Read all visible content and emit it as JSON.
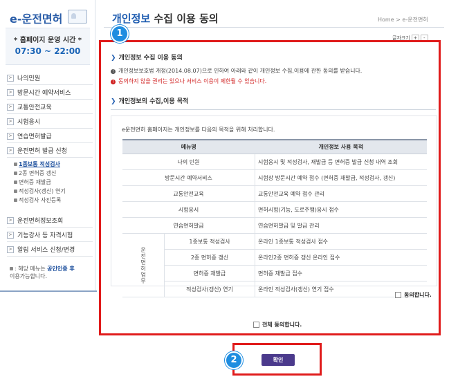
{
  "sidebar": {
    "logo": "e-운전면허",
    "hours_title": "* 홈페이지 운영 시간 *",
    "hours_time": "07:30 ~ 22:00",
    "menu": [
      {
        "label": "나의민원"
      },
      {
        "label": "방문시간 예약서비스"
      },
      {
        "label": "교통안전교육"
      },
      {
        "label": "시험응시"
      },
      {
        "label": "연습면허발급"
      },
      {
        "label": "운전면허 발급 신청"
      }
    ],
    "submenu": [
      {
        "label": "1종보통 적성검사"
      },
      {
        "label": "2종 면허증 갱신"
      },
      {
        "label": "면허증 재발급"
      },
      {
        "label": "적성검사(갱신) 연기"
      },
      {
        "label": "적성검사 사진등록"
      }
    ],
    "menu2": [
      {
        "label": "운전면허정보조회"
      },
      {
        "label": "기능강사 등 자격시험"
      },
      {
        "label": "알림 서비스 신청/변경"
      }
    ],
    "notice_prefix": ": 해당 메뉴는",
    "notice_link": "공인인증 후",
    "notice_suffix": "이용가능합니다."
  },
  "header": {
    "title_hl": "개인정보",
    "title_rest": " 수집 이용 동의",
    "breadcrumb": "Home > e-운전면허",
    "font_label": "글자크기",
    "font_plus": "+",
    "font_minus": "-"
  },
  "badges": {
    "one": "1",
    "two": "2"
  },
  "section1": {
    "title": "개인정보 수집 이용 동의",
    "line1": "개인정보보호법 개정(2014.08.07)으로 인하여 아래와 같이 개인정보 수집,이용에 관한 동의를 받습니다.",
    "line2": "동의하지 않을 권리는 있으나 서비스 이용이 제한될 수 있습니다."
  },
  "section2": {
    "title": "개인정보의 수집,이용 목적",
    "intro": "e운전면허 홈페이지는 개인정보를 다음의 목적을 위해 처리합니다.",
    "col_menu": "메뉴명",
    "col_purpose": "개인정보 사용 목적",
    "rows": [
      {
        "menu": "나의 민원",
        "purpose": "시험응시 및 적성검사, 재발급 등 면허증 발급 신청 내역 조회"
      },
      {
        "menu": "방문시간 예약서비스",
        "purpose": "시험장 방문시간 예약 접수 (면허증 재발급, 적성검사, 갱신)"
      },
      {
        "menu": "교통안전교육",
        "purpose": "교통안전교육 예약 접수 관리"
      },
      {
        "menu": "시험응시",
        "purpose": "면허시험(기능, 도로주행)응시 접수"
      },
      {
        "menu": "연습면허발급",
        "purpose": "연습면허발급 및 발급 관리"
      }
    ],
    "group_label": "운전면허업무",
    "group_rows": [
      {
        "menu": "1종보통 적성검사",
        "purpose": "온라인 1종보통 적성검사 접수"
      },
      {
        "menu": "2종 면허증 갱신",
        "purpose": "온라인2종 면허증 갱신 온라인 접수"
      },
      {
        "menu": "면허증 재발급",
        "purpose": "면허증 재발급 접수"
      },
      {
        "menu": "적성검사(갱신) 연기",
        "purpose": "온라인 적성검사(갱신) 연기 접수"
      }
    ],
    "agree_label": "동의합니다."
  },
  "agree_all_label": "전체 동의합니다.",
  "confirm_label": "확인"
}
